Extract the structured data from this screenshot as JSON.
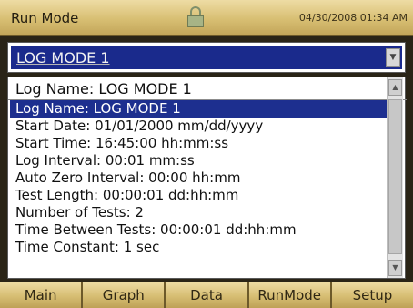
{
  "header": {
    "title": "Run Mode",
    "datetime": "04/30/2008 01:34 AM"
  },
  "mode_select": {
    "value": "LOG MODE 1"
  },
  "log_name_field": {
    "value": "Log Name: LOG MODE 1"
  },
  "settings": [
    {
      "label": "Log Name: LOG MODE 1",
      "selected": true
    },
    {
      "label": "Start Date: 01/01/2000 mm/dd/yyyy"
    },
    {
      "label": "Start Time: 16:45:00 hh:mm:ss"
    },
    {
      "label": "Log Interval: 00:01 mm:ss"
    },
    {
      "label": "Auto Zero Interval: 00:00 hh:mm"
    },
    {
      "label": "Test Length: 00:00:01 dd:hh:mm"
    },
    {
      "label": "Number of Tests: 2"
    },
    {
      "label": "Time Between Tests: 00:00:01 dd:hh:mm"
    },
    {
      "label": "Time Constant: 1 sec"
    }
  ],
  "tabs": [
    "Main",
    "Graph",
    "Data",
    "RunMode",
    "Setup"
  ],
  "icons": {
    "lock": "lock-icon"
  },
  "colors": {
    "header_gold": "#d8bf73",
    "selection_blue": "#1d2f8f"
  }
}
